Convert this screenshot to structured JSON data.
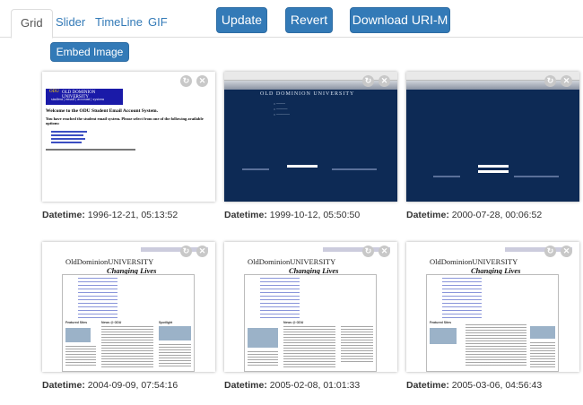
{
  "tabs": [
    {
      "label": "Grid",
      "active": true
    },
    {
      "label": "Slider",
      "active": false
    },
    {
      "label": "TimeLine",
      "active": false
    },
    {
      "label": "GIF",
      "active": false
    }
  ],
  "toolbar": {
    "update_label": "Update",
    "revert_label": "Revert",
    "download_label": "Download URI-M List",
    "embed_label": "Embed Image Grid"
  },
  "colors": {
    "accent": "#337ab7",
    "odu_dark": "#0d2a55",
    "tab_text": "#337ab7"
  },
  "datetime_label": "Datetime:",
  "cards": [
    {
      "datetime": "1996-12-21, 05:13:52",
      "snapshot": {
        "brand": "ODU",
        "banner_title": "OLD DOMINION UNIVERSITY",
        "banner_subtitle": "student | email | account | system",
        "heading": "Welcome to the ODU Student Email Account System.",
        "intro": "You have reached the student email system. Please select from one of the following available options:"
      }
    },
    {
      "datetime": "1999-10-12, 05:50:50",
      "snapshot": {
        "banner_title": "OLD DOMINION UNIVERSITY"
      }
    },
    {
      "datetime": "2000-07-28, 00:06:52",
      "snapshot": {
        "banner_title": "OLD DOMINION UNIVERSITY"
      }
    },
    {
      "datetime": "2004-09-09, 07:54:16",
      "snapshot": {
        "logo_line1": "OldDominionUNIVERSITY",
        "logo_line2": "Changing Lives",
        "sections": [
          "Featured Sites",
          "News @ ODU",
          "Spotlight"
        ]
      }
    },
    {
      "datetime": "2005-02-08, 01:01:33",
      "snapshot": {
        "logo_line1": "OldDominionUNIVERSITY",
        "logo_line2": "Changing Lives",
        "sections": [
          "News @ ODU"
        ]
      }
    },
    {
      "datetime": "2005-03-06, 04:56:43",
      "snapshot": {
        "logo_line1": "OldDominionUNIVERSITY",
        "logo_line2": "Changing Lives",
        "sections": [
          "Featured Sites"
        ]
      }
    }
  ],
  "icons": {
    "refresh": "refresh-icon",
    "close": "close-icon"
  }
}
